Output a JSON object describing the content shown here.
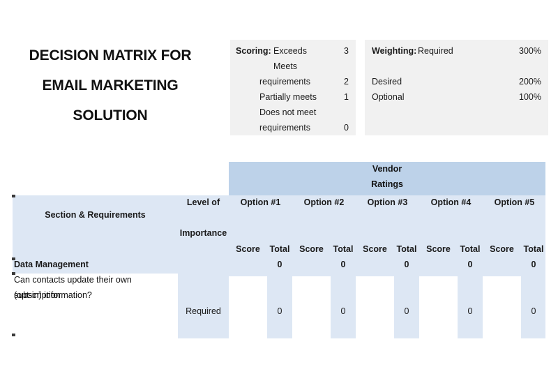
{
  "title": {
    "line1": "DECISION MATRIX FOR",
    "line2": "EMAIL MARKETING",
    "line3": "SOLUTION"
  },
  "scoring_legend": {
    "label": "Scoring:",
    "rows": [
      {
        "text": "Exceeds",
        "value": "3"
      },
      {
        "text": "Meets",
        "value": ""
      },
      {
        "text": "requirements",
        "value": "2"
      },
      {
        "text": "Partially meets",
        "value": "1"
      },
      {
        "text": "Does not meet",
        "value": ""
      },
      {
        "text": "requirements",
        "value": "0"
      }
    ]
  },
  "weighting_legend": {
    "label": "Weighting:",
    "rows": [
      {
        "text": "Required",
        "value": "300%"
      },
      {
        "text": "Desired",
        "value": "200%"
      },
      {
        "text": "Optional",
        "value": "100%"
      }
    ]
  },
  "matrix": {
    "group_header": {
      "line1": "Vendor",
      "line2": "Ratings"
    },
    "col_requirements": "Section & Requirements",
    "col_importance": {
      "line1": "Level of",
      "line2": "Importance"
    },
    "options": [
      {
        "label": "Option #1",
        "score_header": "Score",
        "total_header": "Total",
        "header_total": "0",
        "row_total": "0",
        "score_value": ""
      },
      {
        "label": "Option #2",
        "score_header": "Score",
        "total_header": "Total",
        "header_total": "0",
        "row_total": "0",
        "score_value": ""
      },
      {
        "label": "Option #3",
        "score_header": "Score",
        "total_header": "Total",
        "header_total": "0",
        "row_total": "0",
        "score_value": ""
      },
      {
        "label": "Option #4",
        "score_header": "Score",
        "total_header": "Total",
        "header_total": "0",
        "row_total": "0",
        "score_value": ""
      },
      {
        "label": "Option #5",
        "score_header": "Score",
        "total_header": "Total",
        "header_total": "0",
        "row_total": "0",
        "score_value": ""
      }
    ],
    "section": {
      "name": "Data Management"
    },
    "requirement_row": {
      "question_line1": "Can contacts update their own subscription",
      "question_line2": "(opt-in) information?",
      "importance": "Required"
    }
  },
  "colors": {
    "header_blue": "#bdd2e9",
    "body_blue": "#dde7f4",
    "legend_gray": "#f1f1f1",
    "text": "#111111"
  }
}
